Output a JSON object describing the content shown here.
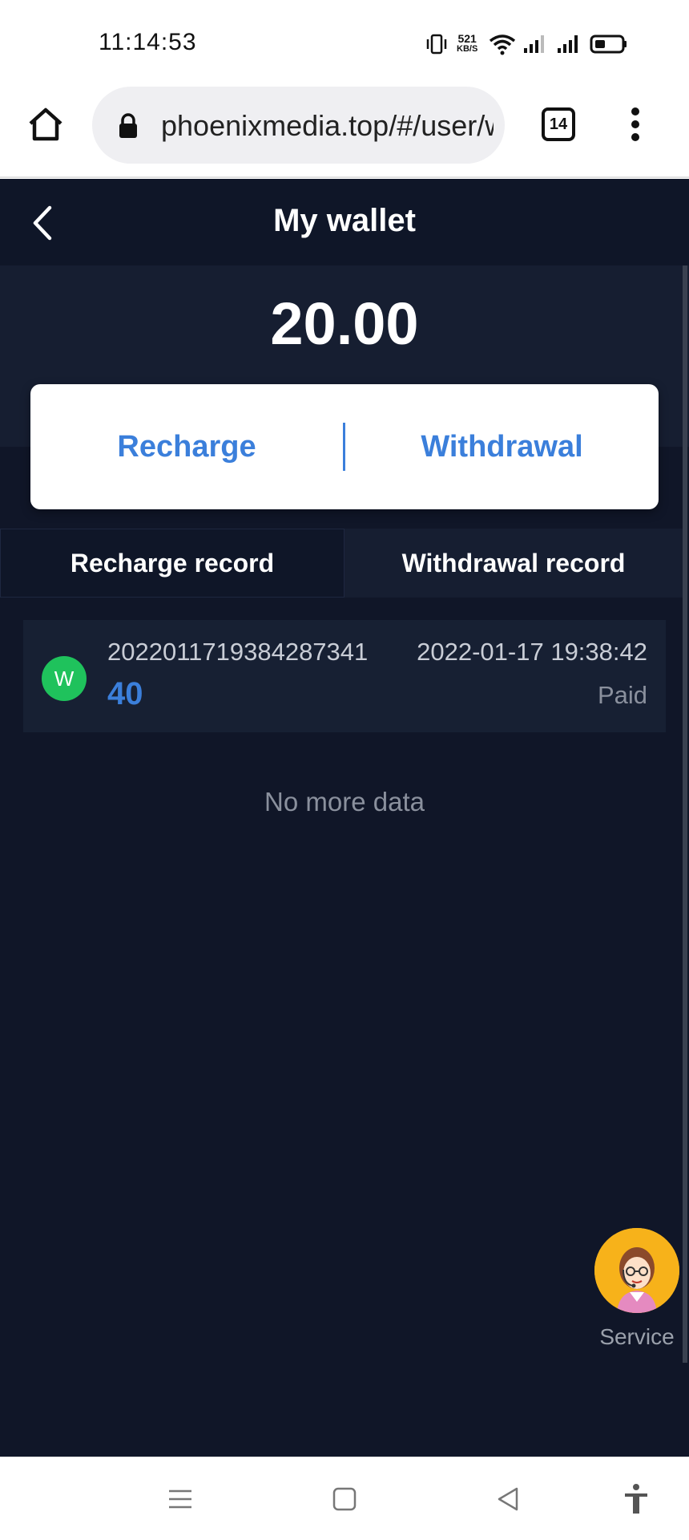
{
  "status_bar": {
    "time": "11:14:53",
    "net_speed_value": "521",
    "net_speed_unit": "KB/S"
  },
  "browser": {
    "url": "phoenixmedia.top/#/user/wallet",
    "tab_count": "14"
  },
  "app": {
    "title": "My wallet",
    "balance": "20.00",
    "actions": {
      "recharge": "Recharge",
      "withdrawal": "Withdrawal"
    },
    "tabs": [
      {
        "label": "Recharge record",
        "active": true
      },
      {
        "label": "Withdrawal record",
        "active": false
      }
    ],
    "records": [
      {
        "avatar_letter": "W",
        "order_id": "2022011719384287341",
        "amount": "40",
        "time": "2022-01-17 19:38:42",
        "status": "Paid"
      }
    ],
    "no_more_text": "No more data",
    "service_label": "Service"
  },
  "colors": {
    "accent_blue": "#3b7fdb",
    "app_background": "#101628",
    "avatar_green": "#1fc25c"
  }
}
